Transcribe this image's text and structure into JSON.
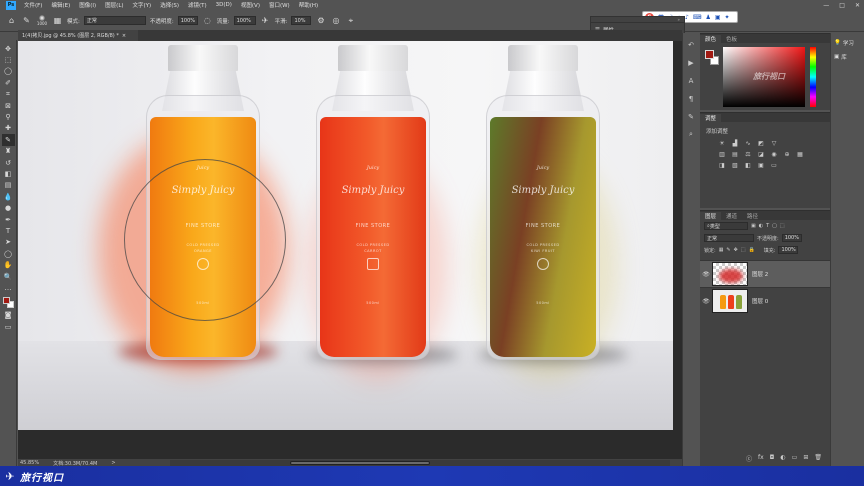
{
  "menu": [
    "文件(F)",
    "编辑(E)",
    "图像(I)",
    "图层(L)",
    "文字(Y)",
    "选择(S)",
    "滤镜(T)",
    "3D(D)",
    "视图(V)",
    "窗口(W)",
    "帮助(H)"
  ],
  "app_icon": "Ps",
  "window_controls": [
    "—",
    "□",
    "✕"
  ],
  "options_bar": {
    "brush_size": "1000",
    "mode_label": "模式:",
    "mode_value": "正常",
    "opacity_label": "不透明度:",
    "opacity_value": "100%",
    "flow_label": "流量:",
    "flow_value": "100%",
    "smoothing_label": "平滑:",
    "smoothing_value": "10%"
  },
  "ime": {
    "label": "英"
  },
  "mini_panel": {
    "tab": "属性",
    "collapse": "»"
  },
  "document_tab": {
    "title": "1(4)拷贝.jpg @ 45.8% (图层 2, RGB/8) *",
    "close": "×"
  },
  "bottles": [
    {
      "script": "Simply Juicy",
      "top_word": "Juicy",
      "store": "FINE STORE",
      "pressed": "COLD PRESSED",
      "flavor": "ORANGE",
      "volume": "500ml",
      "juice": "#f59a12"
    },
    {
      "script": "Simply Juicy",
      "top_word": "Juicy",
      "store": "FINE STORE",
      "pressed": "COLD PRESSED",
      "flavor": "CARROT",
      "volume": "500ml",
      "juice": "#ee3f1c"
    },
    {
      "script": "Simply Juicy",
      "top_word": "Juicy",
      "store": "FINE STORE",
      "pressed": "COLD PRESSED",
      "flavor": "KIWI FRUIT",
      "volume": "500ml",
      "juice": "#7c9a3a"
    }
  ],
  "status": {
    "zoom": "45.85%",
    "doc_size": "文档:30.3M/70.4M",
    "arrow": ">"
  },
  "taskbar": {
    "brand": "旅行视口"
  },
  "color_panel": {
    "tabs": [
      "颜色",
      "色板"
    ],
    "foreground": "#a11a12",
    "background": "#ffffff",
    "watermark": "旅行视口"
  },
  "adjust_panel": {
    "tabs": [
      "调整"
    ],
    "title": "添加调整"
  },
  "layers_panel": {
    "tabs": [
      "图层",
      "通道",
      "路径"
    ],
    "filter_label": "类型",
    "blend_mode": "正常",
    "opacity_label": "不透明度:",
    "opacity_value": "100%",
    "lock_label": "锁定:",
    "fill_label": "填充:",
    "fill_value": "100%",
    "layers": [
      {
        "name": "图层 2",
        "selected": true
      },
      {
        "name": "图层 0",
        "selected": false
      }
    ],
    "footer": [
      "ⓒ",
      "fx",
      "◘",
      "◐",
      "▭",
      "⊞",
      "🗑"
    ]
  },
  "learn_panel": {
    "items": [
      "学习",
      "库"
    ]
  }
}
